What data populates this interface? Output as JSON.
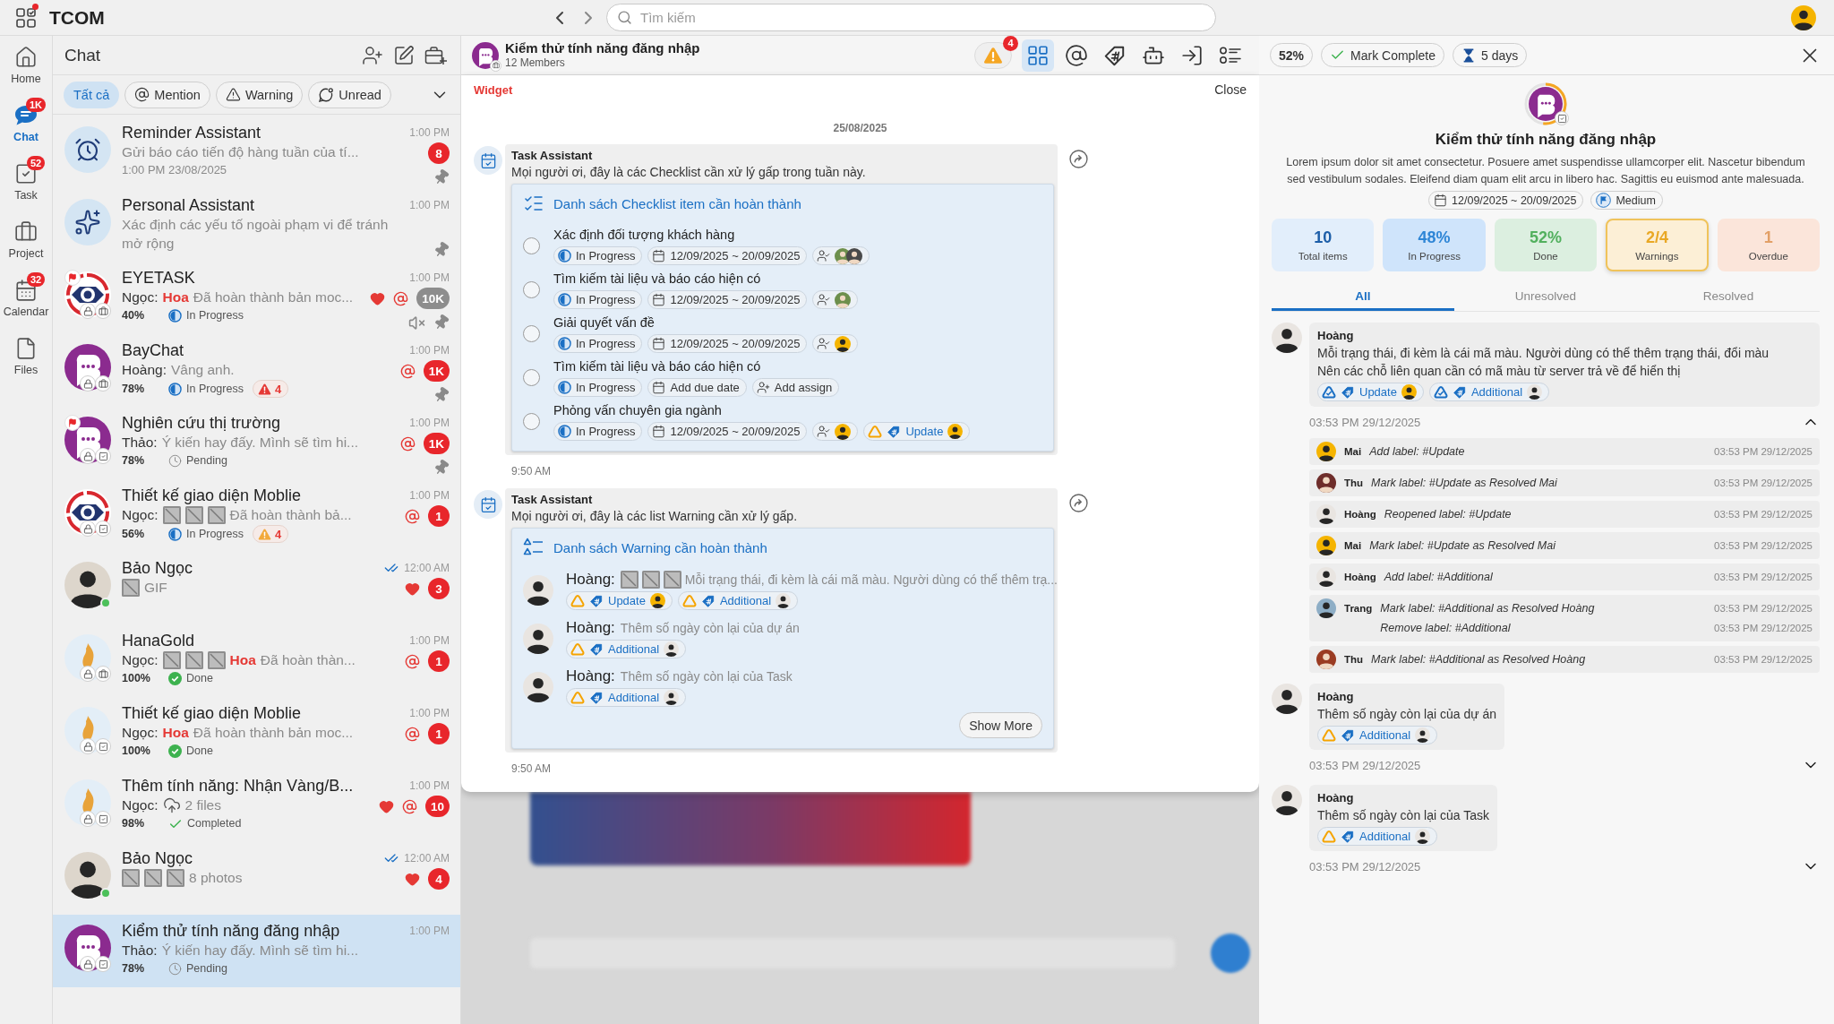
{
  "top_bar": {
    "title": "TCOM",
    "notification": true,
    "search": {
      "placeholder": "Tìm kiếm"
    },
    "avatar": {
      "color": "#f5b400"
    }
  },
  "nav": [
    {
      "kind": "home",
      "label": "Home",
      "selected": false
    },
    {
      "kind": "chat",
      "label": "Chat",
      "selected": true,
      "badge": "1K"
    },
    {
      "kind": "task",
      "label": "Task",
      "selected": false,
      "badge": "52"
    },
    {
      "kind": "project",
      "label": "Project",
      "selected": false
    },
    {
      "kind": "calendar",
      "label": "Calendar",
      "selected": false,
      "badge": "32"
    },
    {
      "kind": "files",
      "label": "Files",
      "selected": false
    }
  ],
  "chat_list": {
    "title": "Chat",
    "filters": [
      {
        "kind": "all",
        "label": "Tất cả",
        "selected": true
      },
      {
        "kind": "mention",
        "label": "Mention",
        "selected": false
      },
      {
        "kind": "warning",
        "label": "Warning",
        "selected": false
      },
      {
        "kind": "unread",
        "label": "Unread",
        "selected": false
      }
    ],
    "items": [
      {
        "name": "Reminder Assistant",
        "avatar": {
          "kind": "alarm_clock"
        },
        "time": "1:00 PM",
        "preview": [
          {
            "kind": "text",
            "text": "Gửi báo cáo tiến độ hàng tuần của tí..."
          }
        ],
        "note": "1:00 PM 23/08/2025",
        "unread": {
          "count": "8",
          "color": "#e8262b"
        },
        "tools": [
          {
            "kind": "pin"
          }
        ],
        "selected": false
      },
      {
        "name": "Personal Assistant",
        "avatar": {
          "kind": "sparkles"
        },
        "time": "1:00 PM",
        "preview": [
          {
            "kind": "text",
            "text": "Xác định các yếu tố ngoài phạm vi để tránh mở rộng"
          }
        ],
        "tools": [
          {
            "kind": "pin"
          }
        ],
        "selected": false
      },
      {
        "name": "EYETASK",
        "avatar": {
          "kind": "eye_logo",
          "badges": [
            {
              "kind": "flag"
            },
            {
              "kind": "lock"
            },
            {
              "kind": "project"
            }
          ]
        },
        "time": "1:00 PM",
        "preview": [
          {
            "kind": "sender",
            "text": "Ngọc:"
          },
          {
            "kind": "mention",
            "text": "Hoa"
          },
          {
            "kind": "text",
            "text": "Đã hoàn thành bản moc..."
          }
        ],
        "progress": "40%",
        "status": {
          "kind": "in_progress",
          "label": "In Progress"
        },
        "reactions": [
          {
            "kind": "heart"
          },
          {
            "kind": "mention"
          }
        ],
        "unread": {
          "count": "10K",
          "color": "#8d8d8d"
        },
        "tools": [
          {
            "kind": "mute"
          },
          {
            "kind": "pin"
          }
        ],
        "selected": false
      },
      {
        "name": "BayChat",
        "avatar": {
          "kind": "chat_logo",
          "badges": [
            {
              "kind": "lock"
            },
            {
              "kind": "project"
            }
          ]
        },
        "time": "1:00 PM",
        "preview": [
          {
            "kind": "sender",
            "text": "Hoàng:"
          },
          {
            "kind": "text",
            "text": "Vâng anh."
          }
        ],
        "progress": "78%",
        "status": {
          "kind": "in_progress",
          "label": "In Progress"
        },
        "warning": {
          "count": "4",
          "color": "#e53935"
        },
        "reactions": [
          {
            "kind": "mention"
          }
        ],
        "unread": {
          "count": "1K",
          "color": "#e8262b"
        },
        "tools": [
          {
            "kind": "pin"
          }
        ],
        "selected": false
      },
      {
        "name": "Nghiên cứu thị trường",
        "avatar": {
          "kind": "chat_logo",
          "badges": [
            {
              "kind": "flag"
            },
            {
              "kind": "lock"
            },
            {
              "kind": "task"
            }
          ]
        },
        "time": "1:00 PM",
        "preview": [
          {
            "kind": "sender",
            "text": "Thảo:"
          },
          {
            "kind": "text",
            "text": "Ý kiến hay đấy. Mình sẽ tìm hi..."
          }
        ],
        "progress": "78%",
        "status": {
          "kind": "pending",
          "label": "Pending"
        },
        "reactions": [
          {
            "kind": "mention"
          }
        ],
        "unread": {
          "count": "1K",
          "color": "#e8262b"
        },
        "tools": [
          {
            "kind": "pin"
          }
        ],
        "selected": false
      },
      {
        "name": "Thiết kế giao diện Moblie",
        "avatar": {
          "kind": "eye_logo",
          "badges": [
            {
              "kind": "lock"
            },
            {
              "kind": "task"
            }
          ]
        },
        "time": "1:00 PM",
        "preview": [
          {
            "kind": "sender",
            "text": "Ngọc:"
          },
          {
            "kind": "image"
          },
          {
            "kind": "image"
          },
          {
            "kind": "image"
          },
          {
            "kind": "text",
            "text": "Đã hoàn thành bả..."
          }
        ],
        "progress": "56%",
        "status": {
          "kind": "in_progress",
          "label": "In Progress"
        },
        "warning": {
          "count": "4",
          "color": "#f2a93b"
        },
        "reactions": [
          {
            "kind": "mention"
          }
        ],
        "unread": {
          "count": "1",
          "color": "#e8262b"
        },
        "selected": false
      },
      {
        "name": "Bảo Ngọc",
        "avatar": {
          "kind": "photo",
          "badges": [
            {
              "kind": "online"
            }
          ]
        },
        "time": "12:00 AM",
        "time_icons": [
          {
            "kind": "double_check"
          }
        ],
        "preview": [
          {
            "kind": "image"
          },
          {
            "kind": "text",
            "text": "GIF"
          }
        ],
        "reactions": [
          {
            "kind": "heart"
          }
        ],
        "unread": {
          "count": "3",
          "color": "#e8262b"
        },
        "selected": false
      },
      {
        "name": "HanaGold",
        "avatar": {
          "kind": "flame_logo",
          "badges": [
            {
              "kind": "lock"
            },
            {
              "kind": "project"
            }
          ]
        },
        "time": "1:00 PM",
        "preview": [
          {
            "kind": "sender",
            "text": "Ngọc:"
          },
          {
            "kind": "image"
          },
          {
            "kind": "image"
          },
          {
            "kind": "image"
          },
          {
            "kind": "mention",
            "text": "Hoa"
          },
          {
            "kind": "text",
            "text": "Đã hoàn thàn..."
          }
        ],
        "progress": "100%",
        "status": {
          "kind": "done",
          "label": "Done"
        },
        "reactions": [
          {
            "kind": "mention"
          }
        ],
        "unread": {
          "count": "1",
          "color": "#e8262b"
        },
        "selected": false
      },
      {
        "name": "Thiết kế giao diện Moblie",
        "avatar": {
          "kind": "flame_logo",
          "badges": [
            {
              "kind": "lock"
            },
            {
              "kind": "task"
            }
          ]
        },
        "time": "1:00 PM",
        "preview": [
          {
            "kind": "sender",
            "text": "Ngọc:"
          },
          {
            "kind": "mention",
            "text": "Hoa"
          },
          {
            "kind": "text",
            "text": "Đã hoàn thành bản moc..."
          }
        ],
        "progress": "100%",
        "status": {
          "kind": "done",
          "label": "Done"
        },
        "reactions": [
          {
            "kind": "mention"
          }
        ],
        "unread": {
          "count": "1",
          "color": "#e8262b"
        },
        "selected": false
      },
      {
        "name": "Thêm tính năng: Nhận Vàng/B...",
        "avatar": {
          "kind": "flame_logo",
          "badges": [
            {
              "kind": "lock"
            },
            {
              "kind": "task"
            }
          ]
        },
        "time": "1:00 PM",
        "preview": [
          {
            "kind": "sender",
            "text": "Ngọc:"
          },
          {
            "kind": "file"
          },
          {
            "kind": "text",
            "text": "2 files"
          }
        ],
        "progress": "98%",
        "status": {
          "kind": "completed",
          "label": "Completed"
        },
        "reactions": [
          {
            "kind": "heart"
          },
          {
            "kind": "mention"
          }
        ],
        "unread": {
          "count": "10",
          "color": "#e8262b"
        },
        "selected": false
      },
      {
        "name": "Bảo Ngọc",
        "avatar": {
          "kind": "photo",
          "badges": [
            {
              "kind": "online"
            }
          ]
        },
        "time": "12:00 AM",
        "time_icons": [
          {
            "kind": "double_check"
          }
        ],
        "preview": [
          {
            "kind": "image"
          },
          {
            "kind": "image"
          },
          {
            "kind": "image"
          },
          {
            "kind": "text",
            "text": "8 photos"
          }
        ],
        "reactions": [
          {
            "kind": "heart"
          }
        ],
        "unread": {
          "count": "4",
          "color": "#e8262b"
        },
        "selected": false
      },
      {
        "name": "Kiểm thử tính năng đăng nhập",
        "avatar": {
          "kind": "chat_logo",
          "badges": [
            {
              "kind": "lock"
            },
            {
              "kind": "task"
            }
          ]
        },
        "time": "1:00 PM",
        "preview": [
          {
            "kind": "sender",
            "text": "Thảo:"
          },
          {
            "kind": "text",
            "text": "Ý kiến hay đấy. Mình sẽ tìm hi..."
          }
        ],
        "progress": "78%",
        "status": {
          "kind": "pending",
          "label": "Pending"
        },
        "selected": true
      }
    ]
  },
  "conversation": {
    "title": "Kiểm thử tính năng đăng nhập",
    "subtitle": "12 Members",
    "avatar": {
      "badges": [
        {
          "kind": "project"
        }
      ]
    },
    "toolbar": [
      {
        "kind": "warning",
        "badge": "4",
        "selected": false
      },
      {
        "kind": "widgets",
        "selected": true
      },
      {
        "kind": "mention",
        "selected": false
      },
      {
        "kind": "tags",
        "selected": false
      },
      {
        "kind": "bot",
        "selected": false
      },
      {
        "kind": "join",
        "selected": false
      },
      {
        "kind": "checklist",
        "selected": false
      }
    ],
    "widget": {
      "label": "Widget",
      "close": "Close",
      "date": "25/08/2025",
      "messages": [
        {
          "sender": "Task Assistant",
          "text": "Mọi người ơi, đây là các Checklist cần xử lý gấp trong tuần này.",
          "time": "9:50 AM",
          "card": {
            "kind": "checklist",
            "title": "Danh sách Checklist item cần hoàn thành",
            "items": [
              {
                "title": "Xác định đối tượng khách hàng",
                "checked": false,
                "status": {
                  "kind": "in_progress",
                  "label": "In Progress"
                },
                "date": "12/09/2025 ~ 20/09/2025",
                "assignees": [
                  {
                    "color": "#6d8f4c"
                  },
                  {
                    "color": "#4a4a4a"
                  }
                ]
              },
              {
                "title": "Tìm kiếm tài liệu và báo cáo hiện có",
                "checked": false,
                "status": {
                  "kind": "in_progress",
                  "label": "In Progress"
                },
                "date": "12/09/2025 ~ 20/09/2025",
                "assignees": [
                  {
                    "color": "#6d8f4c"
                  }
                ]
              },
              {
                "title": "Giải quyết vấn đề",
                "checked": false,
                "status": {
                  "kind": "in_progress",
                  "label": "In Progress"
                },
                "date": "12/09/2025 ~ 20/09/2025",
                "assignees": [
                  {
                    "color": "#f5b400"
                  }
                ]
              },
              {
                "title": "Tìm kiếm tài liệu và báo cáo hiện có",
                "checked": false,
                "status": {
                  "kind": "in_progress",
                  "label": "In Progress"
                },
                "date": "Add due date",
                "assign_prompt": "Add assign"
              },
              {
                "title": "Phỏng vấn chuyên gia ngành",
                "checked": false,
                "status": {
                  "kind": "in_progress",
                  "label": "In Progress"
                },
                "date": "12/09/2025 ~ 20/09/2025",
                "assignees": [
                  {
                    "color": "#f5b400"
                  }
                ],
                "labels": [
                  {
                    "text": "Update",
                    "resolved": false,
                    "avatar": {
                      "color": "#f5b400"
                    }
                  }
                ]
              }
            ]
          }
        },
        {
          "sender": "Task Assistant",
          "text": "Mọi người ơi, đây là các list Warning cần xử lý gấp.",
          "time": "9:50 AM",
          "card": {
            "kind": "warnings",
            "title": "Danh sách Warning cần hoàn thành",
            "more": "Show More",
            "items": [
              {
                "author": "Hoàng:",
                "avatar": {
                  "color": "#e9e5e1"
                },
                "preview": [
                  {
                    "kind": "image"
                  },
                  {
                    "kind": "image"
                  },
                  {
                    "kind": "image"
                  },
                  {
                    "kind": "text",
                    "text": "Mỗi trạng thái, đi kèm là cái mã màu. Người dùng có thể thêm trạ..."
                  }
                ],
                "labels": [
                  {
                    "text": "Update",
                    "resolved": false,
                    "avatar": {
                      "color": "#f5b400"
                    }
                  },
                  {
                    "text": "Additional",
                    "resolved": false,
                    "avatar": {
                      "color": "#e9e5e1"
                    }
                  }
                ]
              },
              {
                "author": "Hoàng:",
                "avatar": {
                  "color": "#e9e5e1"
                },
                "preview": [
                  {
                    "kind": "text",
                    "text": "Thêm số ngày còn lại của dự án"
                  }
                ],
                "labels": [
                  {
                    "text": "Additional",
                    "resolved": false,
                    "avatar": {
                      "color": "#e9e5e1"
                    }
                  }
                ]
              },
              {
                "author": "Hoàng:",
                "avatar": {
                  "color": "#e9e5e1"
                },
                "preview": [
                  {
                    "kind": "text",
                    "text": "Thêm số ngày còn lại của Task"
                  }
                ],
                "labels": [
                  {
                    "text": "Additional",
                    "resolved": false,
                    "avatar": {
                      "color": "#e9e5e1"
                    }
                  }
                ]
              }
            ]
          }
        }
      ]
    }
  },
  "task_panel": {
    "progress": "52%",
    "complete": "Mark Complete",
    "remaining": "5 days",
    "avatar": {
      "level": 0.52,
      "badges": [
        {
          "kind": "task"
        }
      ]
    },
    "title": "Kiểm thử tính năng đăng nhập",
    "description": "Lorem ipsum dolor sit amet consectetur. Posuere amet suspendisse ullamcorper elit. Nascetur bibendum sed vestibulum sodales. Eleifend diam quam elit arcu in libero hac. Sagittis eu euismod ante malesuada.",
    "date": "12/09/2025 ~ 20/09/2025",
    "priority": "Medium",
    "stats": [
      {
        "kind": "total",
        "value": "10",
        "label": "Total items",
        "selected": false
      },
      {
        "kind": "in_progress",
        "value": "48%",
        "label": "In Progress",
        "selected": false
      },
      {
        "kind": "done",
        "value": "52%",
        "label": "Done",
        "selected": false
      },
      {
        "kind": "warnings",
        "value": "2/4",
        "label": "Warnings",
        "selected": true
      },
      {
        "kind": "overdue",
        "value": "1",
        "label": "Overdue",
        "selected": false
      }
    ],
    "tabs": [
      {
        "label": "All",
        "selected": true
      },
      {
        "label": "Unresolved",
        "selected": false
      },
      {
        "label": "Resolved",
        "selected": false
      }
    ],
    "threads": [
      {
        "author": "Hoàng",
        "avatar": {
          "color": "#e9e5e1"
        },
        "lines": [
          "Mỗi trạng thái, đi kèm là cái mã màu. Người dùng có thể thêm trạng thái, đổi màu",
          "Nên các chỗ liên quan cần có mã màu từ server trả về để hiển thị"
        ],
        "labels": [
          {
            "text": "Update",
            "resolved": true,
            "avatar": {
              "color": "#f5b400"
            }
          },
          {
            "text": "Additional",
            "resolved": true,
            "avatar": {
              "color": "#e9e5e1"
            }
          }
        ],
        "time": "03:53 PM 29/12/2025",
        "expanded": true,
        "history": [
          {
            "name": "Mai",
            "avatar": {
              "color": "#f5b400"
            },
            "entries": [
              {
                "text": "Add label: #Update",
                "time": "03:53 PM 29/12/2025"
              }
            ]
          },
          {
            "name": "Thu",
            "avatar": {
              "color": "#6e2d2a"
            },
            "entries": [
              {
                "text": "Mark label: #Update as Resolved Mai",
                "time": "03:53 PM 29/12/2025"
              }
            ]
          },
          {
            "name": "Hoàng",
            "avatar": {
              "color": "#e9e5e1"
            },
            "entries": [
              {
                "text": "Reopened label: #Update",
                "time": "03:53 PM 29/12/2025"
              }
            ]
          },
          {
            "name": "Mai",
            "avatar": {
              "color": "#f5b400"
            },
            "entries": [
              {
                "text": "Mark label: #Update as Resolved Mai",
                "time": "03:53 PM 29/12/2025"
              }
            ]
          },
          {
            "name": "Hoàng",
            "avatar": {
              "color": "#e9e5e1"
            },
            "entries": [
              {
                "text": "Add label: #Additional",
                "time": "03:53 PM 29/12/2025"
              }
            ]
          },
          {
            "name": "Trang",
            "avatar": {
              "color": "#8eaec6"
            },
            "entries": [
              {
                "text": "Mark label: #Additional as Resolved Hoàng",
                "time": "03:53 PM 29/12/2025"
              },
              {
                "text": "Remove label: #Additional",
                "time": "03:53 PM 29/12/2025"
              }
            ]
          },
          {
            "name": "Thu",
            "avatar": {
              "color": "#9a3b22"
            },
            "entries": [
              {
                "text": "Mark label: #Additional as Resolved Hoàng",
                "time": "03:53 PM 29/12/2025"
              }
            ]
          }
        ]
      },
      {
        "author": "Hoàng",
        "avatar": {
          "color": "#e9e5e1"
        },
        "lines": [
          "Thêm số ngày còn lại của dự án"
        ],
        "labels": [
          {
            "text": "Additional",
            "resolved": false,
            "avatar": {
              "color": "#e9e5e1"
            }
          }
        ],
        "time": "03:53 PM 29/12/2025",
        "expanded": false
      },
      {
        "author": "Hoàng",
        "avatar": {
          "color": "#e9e5e1"
        },
        "lines": [
          "Thêm số ngày còn lại của Task"
        ],
        "labels": [
          {
            "text": "Additional",
            "resolved": false,
            "avatar": {
              "color": "#e9e5e1"
            }
          }
        ],
        "time": "03:53 PM 29/12/2025",
        "expanded": false
      }
    ]
  }
}
